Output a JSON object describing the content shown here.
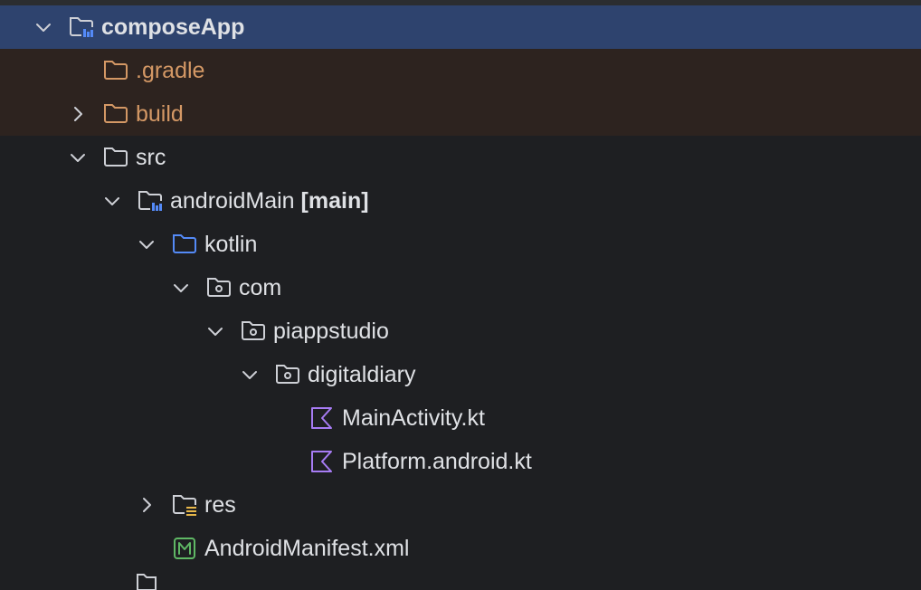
{
  "tree": {
    "items": [
      {
        "label": "composeApp",
        "icon": "module-folder-icon",
        "expanded": true,
        "selected": true
      },
      {
        "label": ".gradle",
        "icon": "excluded-folder-icon"
      },
      {
        "label": "build",
        "icon": "excluded-folder-icon",
        "expanded": false
      },
      {
        "label": "src",
        "icon": "folder-icon",
        "expanded": true
      },
      {
        "label": "androidMain",
        "suffix": "[main]",
        "icon": "module-folder-icon",
        "expanded": true
      },
      {
        "label": "kotlin",
        "icon": "source-folder-icon",
        "expanded": true
      },
      {
        "label": "com",
        "icon": "package-icon",
        "expanded": true
      },
      {
        "label": "piappstudio",
        "icon": "package-icon",
        "expanded": true
      },
      {
        "label": "digitaldiary",
        "icon": "package-icon",
        "expanded": true
      },
      {
        "label": "MainActivity.kt",
        "icon": "kotlin-file-icon"
      },
      {
        "label": "Platform.android.kt",
        "icon": "kotlin-file-icon"
      },
      {
        "label": "res",
        "icon": "resources-folder-icon",
        "expanded": false
      },
      {
        "label": "AndroidManifest.xml",
        "icon": "manifest-file-icon"
      }
    ]
  },
  "colors": {
    "background": "#1e1f22",
    "selected_row": "#2e436e",
    "excluded_row": "#2d231f",
    "excluded_text": "#d49865",
    "text": "#dfe1e5",
    "source_folder": "#548af7",
    "kotlin_icon": "#a77cf4",
    "manifest_icon": "#5fb865"
  }
}
